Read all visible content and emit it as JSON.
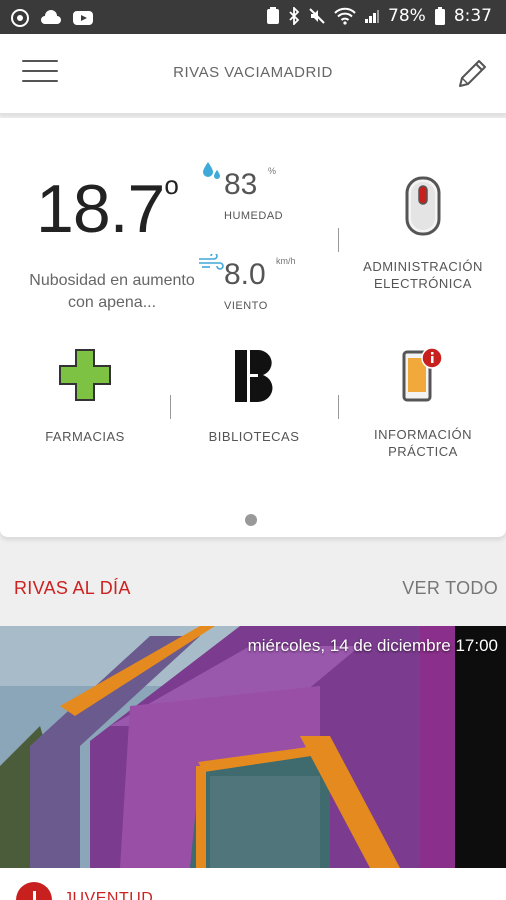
{
  "status_bar": {
    "battery": "78%",
    "time": "8:37",
    "icons": [
      "target-icon",
      "cloud-icon",
      "youtube-icon",
      "notification-icon",
      "bluetooth-icon",
      "mute-icon",
      "wifi-icon",
      "signal-icon",
      "battery-icon"
    ]
  },
  "app_bar": {
    "title": "RIVAS VACIAMADRID",
    "menu_icon": "hamburger-menu-icon",
    "edit_icon": "pencil-icon"
  },
  "weather": {
    "temperature": "18.7",
    "degree": "o",
    "description": "Nubosidad en aumento con apena...",
    "humidity_value": "83",
    "humidity_unit": "%",
    "humidity_label": "HUMEDAD",
    "wind_value": "8.0",
    "wind_unit": "km/h",
    "wind_label": "VIENTO"
  },
  "tiles": [
    {
      "label": "ADMINISTRACIÓN ELECTRÓNICA",
      "icon": "mouse-icon"
    },
    {
      "label": "FARMACIAS",
      "icon": "pharmacy-cross-icon"
    },
    {
      "label": "BIBLIOTECAS",
      "icon": "library-b-icon"
    },
    {
      "label": "INFORMACIÓN PRÁCTICA",
      "icon": "phone-info-icon"
    }
  ],
  "section": {
    "title": "RIVAS AL DÍA",
    "view_all": "VER TODO"
  },
  "news": {
    "date": "miércoles, 14 de diciembre 17:00",
    "category": "JUVENTUD"
  },
  "colors": {
    "accent": "#c8201e",
    "pharmacy_green": "#7dc242",
    "humidity_blue": "#3fa9d8"
  }
}
